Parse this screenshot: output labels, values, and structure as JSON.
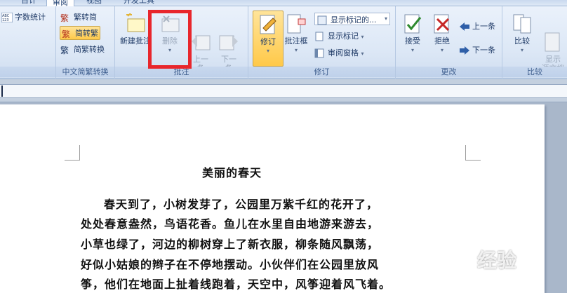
{
  "tabs": [
    {
      "label": "百计"
    },
    {
      "label": "审阅"
    },
    {
      "label": "视图"
    },
    {
      "label": "开发工具"
    }
  ],
  "groups": {
    "proofing": {
      "word_count_label": "字数统计"
    },
    "chinese_convert": {
      "label": "中文简繁转换",
      "to_simplified": "繁转简",
      "to_traditional": "简转繁",
      "convert": "简繁转换"
    },
    "comments": {
      "label": "批注",
      "new_comment": "新建批注",
      "delete": "删除",
      "previous": "上一\n条",
      "next": "下一\n条"
    },
    "tracking": {
      "label": "修订",
      "track_changes": "修订",
      "balloons": "批注框",
      "display_markup_select": "显示标记的...",
      "show_markup": "显示标记",
      "reviewing_pane": "审阅窗格"
    },
    "changes": {
      "label": "更改",
      "accept": "接受",
      "reject": "拒绝",
      "previous": "上一条",
      "next": "下一条"
    },
    "compare": {
      "label": "比较",
      "compare": "比较",
      "show_source": "显示\n源文档"
    }
  },
  "document": {
    "title": "美丽的春天",
    "lines": [
      "春天到了，小树发芽了，公园里万紫千红的花开了，",
      "处处春意盎然，鸟语花香。鱼儿在水里自由地游来游去，",
      "小草也绿了，河边的柳树穿上了新衣服，柳条随风飘荡，",
      "好似小姑娘的辫子在不停地摆动。小伙伴们在公园里放风",
      "筝，他们在地面上扯着线跑着，天空中，风筝迎着风飞着。"
    ]
  },
  "watermark": "经验",
  "colors": {
    "highlight": "#e8262c",
    "ribbon": "#dde8f6",
    "page": "#ffffff"
  }
}
